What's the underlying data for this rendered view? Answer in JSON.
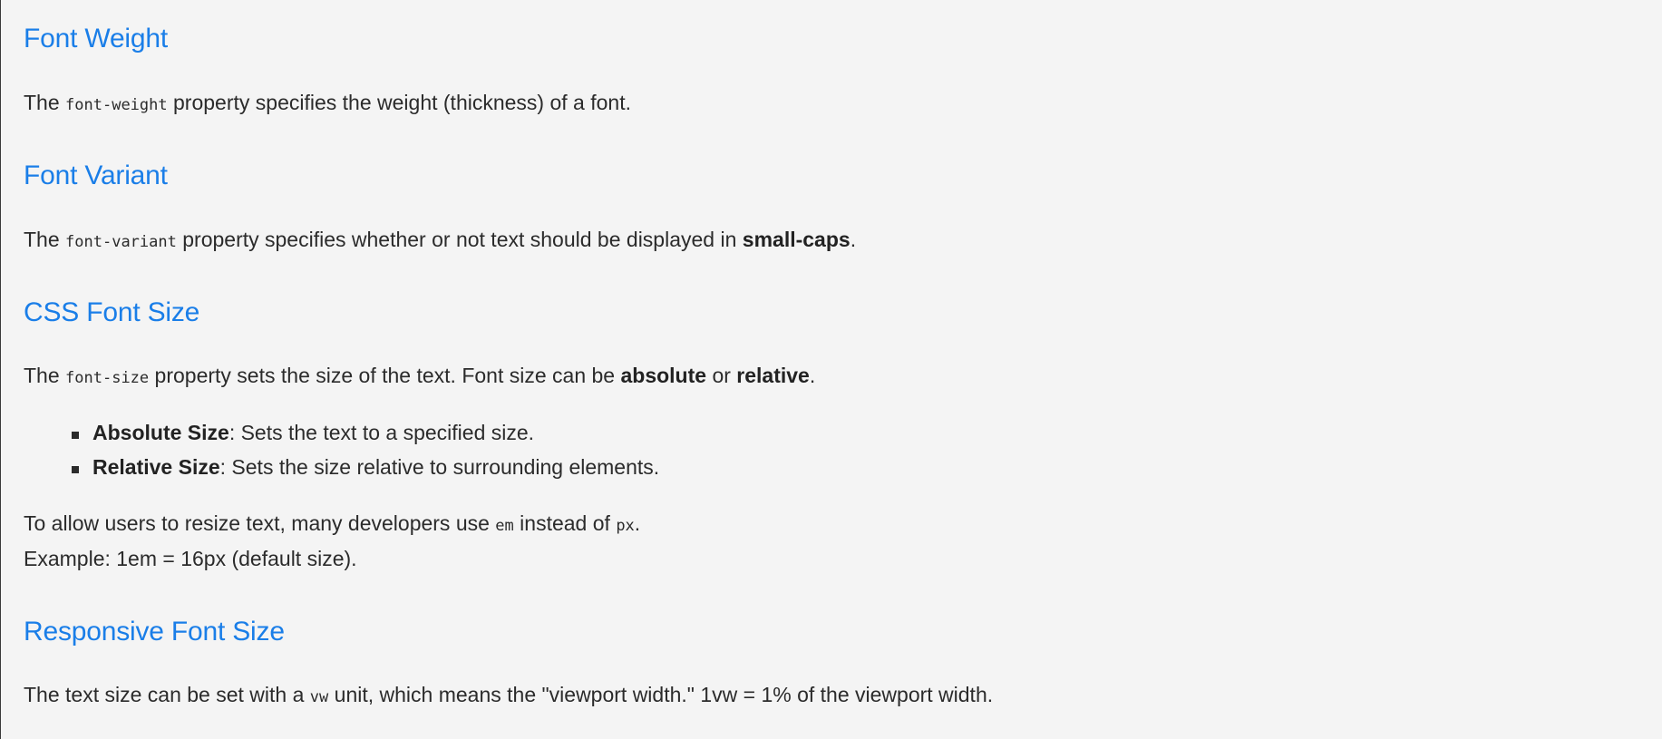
{
  "sections": [
    {
      "heading": "Font Weight",
      "para": {
        "pre": "The ",
        "code": "font-weight",
        "post": " property specifies the weight (thickness) of a font."
      }
    },
    {
      "heading": "Font Variant",
      "para": {
        "pre": "The ",
        "code": "font-variant",
        "mid": " property specifies whether or not text should be displayed in ",
        "bold": "small-caps",
        "post": "."
      }
    },
    {
      "heading": "CSS Font Size",
      "para": {
        "pre": "The ",
        "code": "font-size",
        "mid": " property sets the size of the text. Font size can be ",
        "bold1": "absolute",
        "mid2": " or ",
        "bold2": "relative",
        "post": "."
      },
      "list": [
        {
          "term": "Absolute Size",
          "desc": ": Sets the text to a specified size."
        },
        {
          "term": "Relative Size",
          "desc": ": Sets the size relative to surrounding elements."
        }
      ],
      "note": {
        "pre": "To allow users to resize text, many developers use ",
        "code1": "em",
        "mid": " instead of ",
        "code2": "px",
        "post": ".",
        "line2": "Example: 1em = 16px (default size)."
      }
    },
    {
      "heading": "Responsive Font Size",
      "para": {
        "pre": "The text size can be set with a ",
        "code": "vw",
        "post": " unit, which means the \"viewport width.\" 1vw = 1% of the viewport width."
      }
    }
  ]
}
